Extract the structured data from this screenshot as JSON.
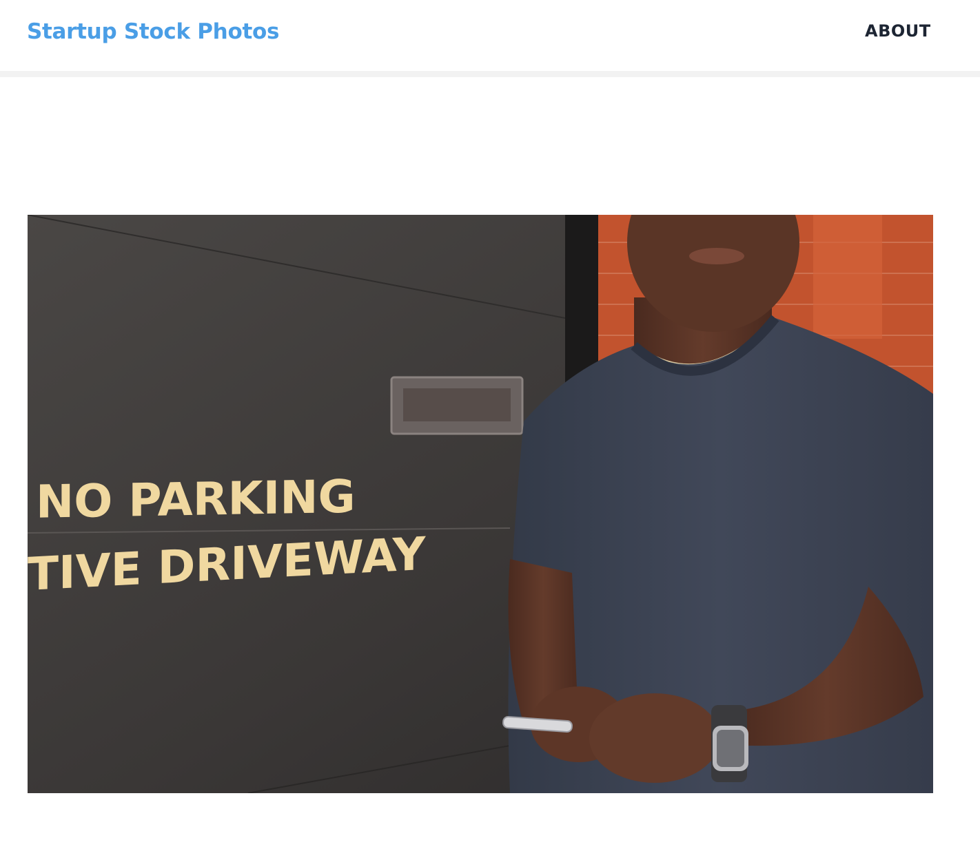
{
  "header": {
    "brand": "Startup Stock Photos",
    "nav": [
      {
        "label": "ABOUT"
      }
    ]
  },
  "photo": {
    "sign_line_1": "NO PARKING",
    "sign_line_2": "TIVE DRIVEWAY"
  },
  "colors": {
    "brand": "#4a9ee6",
    "nav_text": "#1d2533",
    "sign_text": "#f0d8a0",
    "wall": "#3b3837",
    "brick": "#c2532e",
    "shirt": "#3d4454",
    "skin": "#5a3526"
  }
}
